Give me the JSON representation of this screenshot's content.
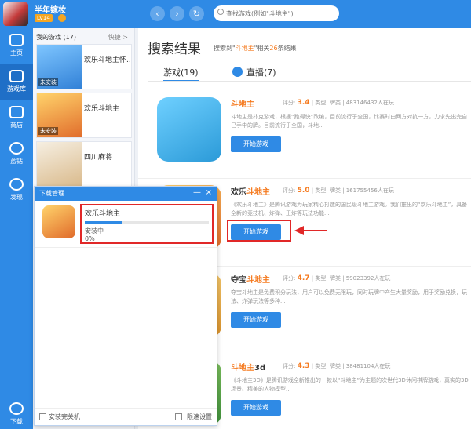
{
  "user": {
    "name": "半年嫁妆",
    "level": "LV14"
  },
  "search": {
    "placeholder": "查找游戏(例如\"斗地主\")"
  },
  "sidebar": {
    "items": [
      {
        "label": "主页",
        "icon": "home-icon"
      },
      {
        "label": "游戏库",
        "icon": "gamepad-icon"
      },
      {
        "label": "商店",
        "icon": "store-icon"
      },
      {
        "label": "蓝钻",
        "icon": "diamond-icon"
      },
      {
        "label": "发现",
        "icon": "compass-icon"
      }
    ],
    "bottom_label": "下载"
  },
  "my_games": {
    "header": "我的游戏 (17)",
    "shortcut": "快捷 >",
    "items": [
      {
        "title": "欢乐斗地主怀...",
        "tag": "未安装"
      },
      {
        "title": "欢乐斗地主",
        "tag": "未安装"
      },
      {
        "title": "四川麻将",
        "tag": ""
      }
    ]
  },
  "results": {
    "title": "搜索结果",
    "summary_prefix": "搜索到\"",
    "keyword": "斗地主",
    "summary_mid": "\"相关",
    "count": "26",
    "summary_suffix": "条结果",
    "tabs": [
      {
        "label": "游戏(19)"
      },
      {
        "label": "直播(7)"
      }
    ],
    "games": [
      {
        "prefix": "",
        "keyword": "斗地主",
        "suffix": "",
        "score_label": "评分:",
        "score": "3.4",
        "type_label": "类型:",
        "type": "牌类",
        "players": "483146432人在玩",
        "desc": "斗地主是扑克游戏，根据“跑得快”改编，目前流行于全国，比赛时由两方对抗一方，力求先出完自己手中的牌。目前流行于全国，斗地...",
        "button": "开始游戏"
      },
      {
        "prefix": "欢乐",
        "keyword": "斗地主",
        "suffix": "",
        "score_label": "评分:",
        "score": "5.0",
        "type_label": "类型:",
        "type": "牌类",
        "players": "161755456人在玩",
        "desc": "《欢乐斗地主》是腾讯游戏为玩家精心打造的国民级斗地主游戏。我们推出的“欢乐斗地主”，具备全新的竞技机、炸弹、王炸等玩法功能...",
        "button": "开始游戏"
      },
      {
        "prefix": "夺宝",
        "keyword": "斗地主",
        "suffix": "",
        "score_label": "评分:",
        "score": "4.7",
        "type_label": "类型:",
        "type": "牌类",
        "players": "59023392人在玩",
        "desc": "夺宝斗地主是免费积分玩法，用户可以免费无限玩，同时玩牌中产生大量奖励，用于奖励兑换，玩法、炸弹玩法等多种...",
        "button": "开始游戏"
      },
      {
        "prefix": "",
        "keyword": "斗地主",
        "suffix": "3d",
        "score_label": "评分:",
        "score": "4.3",
        "type_label": "类型:",
        "type": "牌类",
        "players": "38481104人在玩",
        "desc": "《斗地主3D》是腾讯游戏全新推出的一款以“斗地主”为主题的次世代3D休闲棋牌游戏，真实的3D场景、精美的人物模型...",
        "button": "开始游戏"
      }
    ]
  },
  "download_manager": {
    "title": "下载管理",
    "item_name": "欢乐斗地主",
    "status": "安装中",
    "percent_label": "0%",
    "progress": 0.3,
    "shutdown_label": "安装完关机",
    "speed_label": "限速设置",
    "minimize": "—",
    "close": "×"
  },
  "colors": {
    "accent": "#2f8ae5",
    "highlight": "#f57a1f",
    "annotation": "#e12828"
  }
}
